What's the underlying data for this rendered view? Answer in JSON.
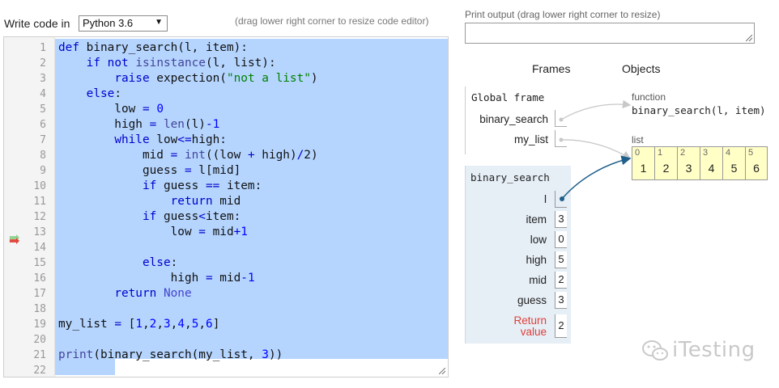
{
  "toolbar": {
    "write_label": "Write code in",
    "language": "Python 3.6",
    "resize_hint": "(drag lower right corner to resize code editor)"
  },
  "editor": {
    "line_numbers": [
      "1",
      "2",
      "3",
      "4",
      "5",
      "6",
      "7",
      "8",
      "9",
      "10",
      "11",
      "12",
      "13",
      "14",
      "15",
      "16",
      "17",
      "18",
      "19",
      "20",
      "21",
      "22"
    ],
    "current_line": "11",
    "previous_line": "11"
  },
  "print_output": {
    "label": "Print output (drag lower right corner to resize)",
    "value": ""
  },
  "viz": {
    "frames_header": "Frames",
    "objects_header": "Objects",
    "global_frame": {
      "title": "Global frame",
      "vars": [
        "binary_search",
        "my_list"
      ]
    },
    "bs_frame": {
      "title": "binary_search",
      "vars": [
        {
          "name": "l",
          "value": ""
        },
        {
          "name": "item",
          "value": "3"
        },
        {
          "name": "low",
          "value": "0"
        },
        {
          "name": "high",
          "value": "5"
        },
        {
          "name": "mid",
          "value": "2"
        },
        {
          "name": "guess",
          "value": "3"
        }
      ],
      "return_label_1": "Return",
      "return_label_2": "value",
      "return_value": "2"
    },
    "function_obj": {
      "label": "function",
      "signature": "binary_search(l, item)"
    },
    "list_obj": {
      "label": "list",
      "indices": [
        "0",
        "1",
        "2",
        "3",
        "4",
        "5"
      ],
      "values": [
        "1",
        "2",
        "3",
        "4",
        "5",
        "6"
      ]
    }
  },
  "watermark": {
    "text": "iTesting"
  },
  "colors": {
    "selection": "#b5d5ff",
    "keyword": "#0000cc",
    "string": "#008000",
    "current_arrow": "#e0473c",
    "previous_arrow": "#8fd38f",
    "list_bg": "#ffffc6",
    "frame_bg": "#e6eef6",
    "pointer_blue": "#1f5f8b"
  },
  "icons": {
    "current_line": "right-arrow-icon",
    "previous_line": "right-arrow-icon",
    "select_caret": "caret-down-icon",
    "watermark": "wechat-icon"
  }
}
